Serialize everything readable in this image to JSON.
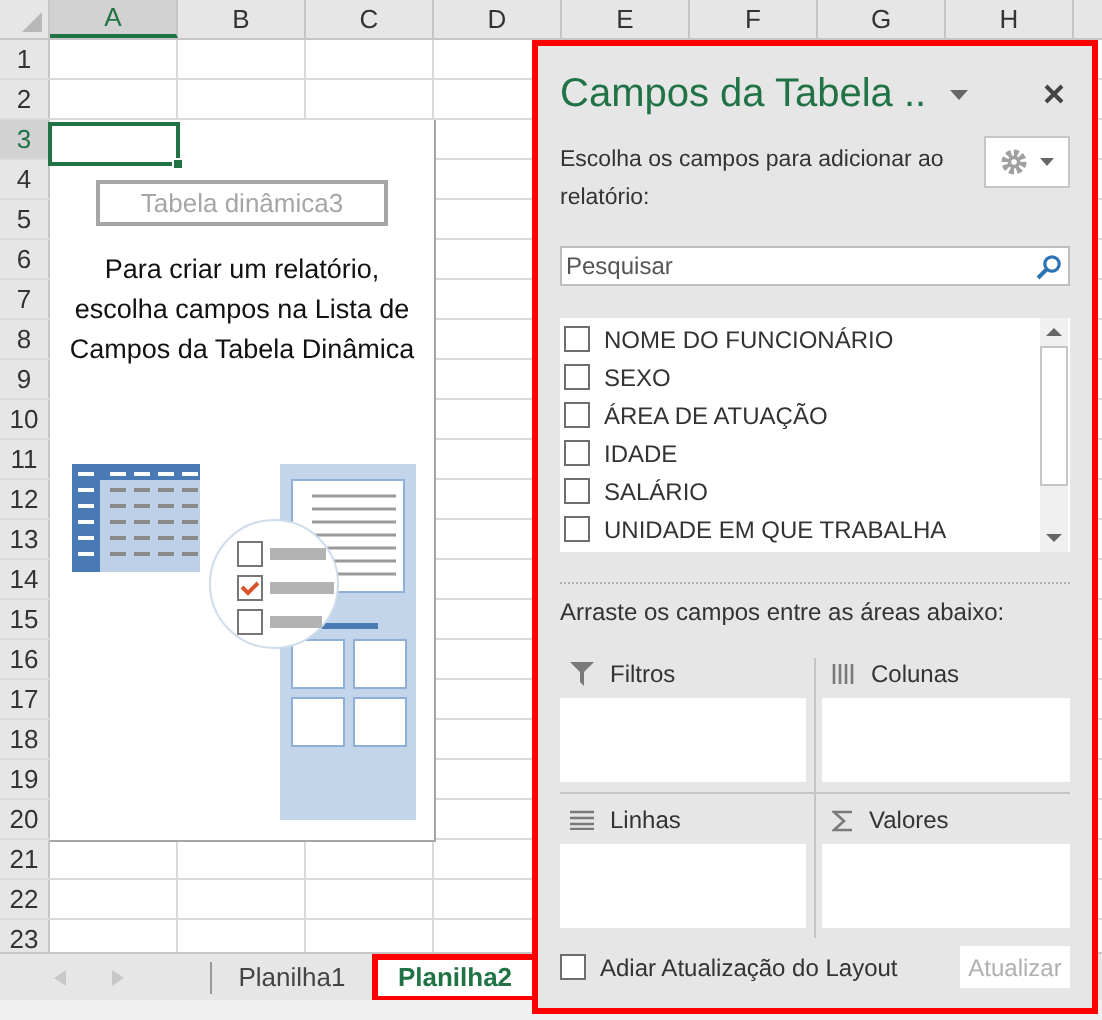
{
  "columns": [
    {
      "label": "A",
      "selected": true
    },
    {
      "label": "B",
      "selected": false
    },
    {
      "label": "C",
      "selected": false
    },
    {
      "label": "D",
      "selected": false
    },
    {
      "label": "E",
      "selected": false
    },
    {
      "label": "F",
      "selected": false
    },
    {
      "label": "G",
      "selected": false
    },
    {
      "label": "H",
      "selected": false
    }
  ],
  "rows": [
    {
      "label": "1",
      "selected": false
    },
    {
      "label": "2",
      "selected": false
    },
    {
      "label": "3",
      "selected": true
    },
    {
      "label": "4",
      "selected": false
    },
    {
      "label": "5",
      "selected": false
    },
    {
      "label": "6",
      "selected": false
    },
    {
      "label": "7",
      "selected": false
    },
    {
      "label": "8",
      "selected": false
    },
    {
      "label": "9",
      "selected": false
    },
    {
      "label": "10",
      "selected": false
    },
    {
      "label": "11",
      "selected": false
    },
    {
      "label": "12",
      "selected": false
    },
    {
      "label": "13",
      "selected": false
    },
    {
      "label": "14",
      "selected": false
    },
    {
      "label": "15",
      "selected": false
    },
    {
      "label": "16",
      "selected": false
    },
    {
      "label": "17",
      "selected": false
    },
    {
      "label": "18",
      "selected": false
    },
    {
      "label": "19",
      "selected": false
    },
    {
      "label": "20",
      "selected": false
    },
    {
      "label": "21",
      "selected": false
    },
    {
      "label": "22",
      "selected": false
    },
    {
      "label": "23",
      "selected": false
    }
  ],
  "pivot_placeholder": {
    "name": "Tabela dinâmica3",
    "message": "Para criar um relatório, escolha campos na Lista de Campos da Tabela Dinâmica"
  },
  "sheet_tabs": [
    {
      "label": "Planilha1",
      "selected": false,
      "highlighted": false
    },
    {
      "label": "Planilha2",
      "selected": true,
      "highlighted": true
    }
  ],
  "field_pane": {
    "highlighted": true,
    "title": "Campos da Tabela ..",
    "subtitle": "Escolha os campos para adicionar ao relatório:",
    "search": {
      "placeholder": "Pesquisar"
    },
    "fields": [
      {
        "label": "NOME DO FUNCIONÁRIO",
        "checked": false
      },
      {
        "label": "SEXO",
        "checked": false
      },
      {
        "label": "ÁREA DE ATUAÇÃO",
        "checked": false
      },
      {
        "label": "IDADE",
        "checked": false
      },
      {
        "label": "SALÁRIO",
        "checked": false
      },
      {
        "label": "UNIDADE EM QUE TRABALHA",
        "checked": false
      }
    ],
    "drag_hint": "Arraste os campos entre as áreas abaixo:",
    "areas": [
      {
        "kind": "filters",
        "label": "Filtros"
      },
      {
        "kind": "columns",
        "label": "Colunas"
      },
      {
        "kind": "rows",
        "label": "Linhas"
      },
      {
        "kind": "values",
        "label": "Valores"
      }
    ],
    "defer": {
      "label": "Adiar Atualização do Layout",
      "checked": false
    },
    "update_button": "Atualizar"
  }
}
